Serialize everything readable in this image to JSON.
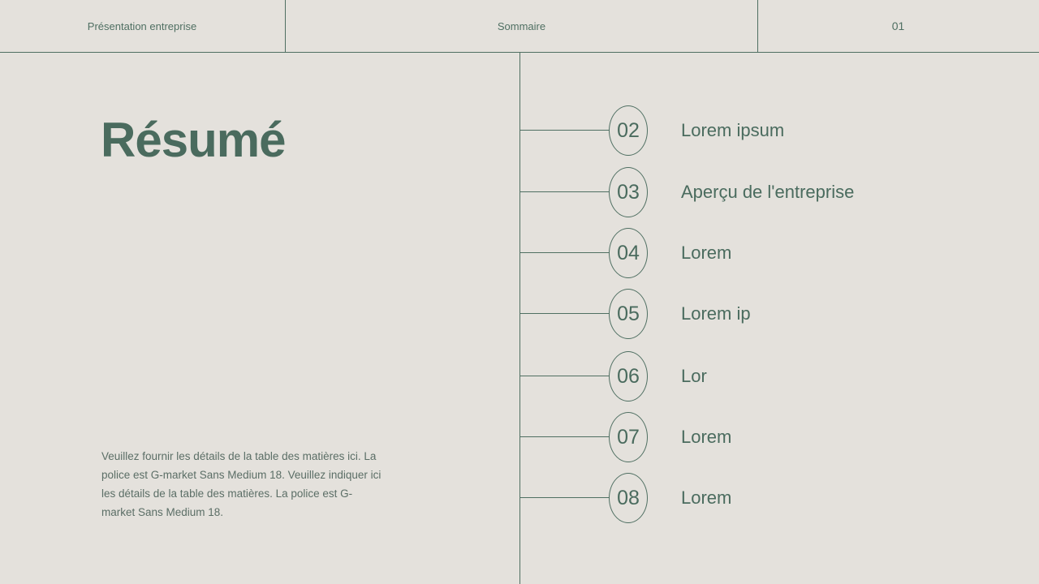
{
  "header": {
    "company": "Présentation entreprise",
    "section": "Sommaire",
    "page_number": "01"
  },
  "main": {
    "title": "Résumé",
    "description": "Veuillez fournir les détails de la table des matières ici. La police est G-market Sans Medium 18. Veuillez indiquer ici les détails de la table des matières. La police est G-market Sans Medium 18."
  },
  "toc": {
    "items": [
      {
        "number": "02",
        "label": "Lorem ipsum"
      },
      {
        "number": "03",
        "label": "Aperçu de l'entreprise"
      },
      {
        "number": "04",
        "label": "Lorem"
      },
      {
        "number": "05",
        "label": "Lorem ip"
      },
      {
        "number": "06",
        "label": "Lor"
      },
      {
        "number": "07",
        "label": "Lorem"
      },
      {
        "number": "08",
        "label": "Lorem"
      }
    ]
  },
  "colors": {
    "background": "#e4e1dc",
    "accent": "#4a6b5e",
    "line": "#4f6f62"
  }
}
